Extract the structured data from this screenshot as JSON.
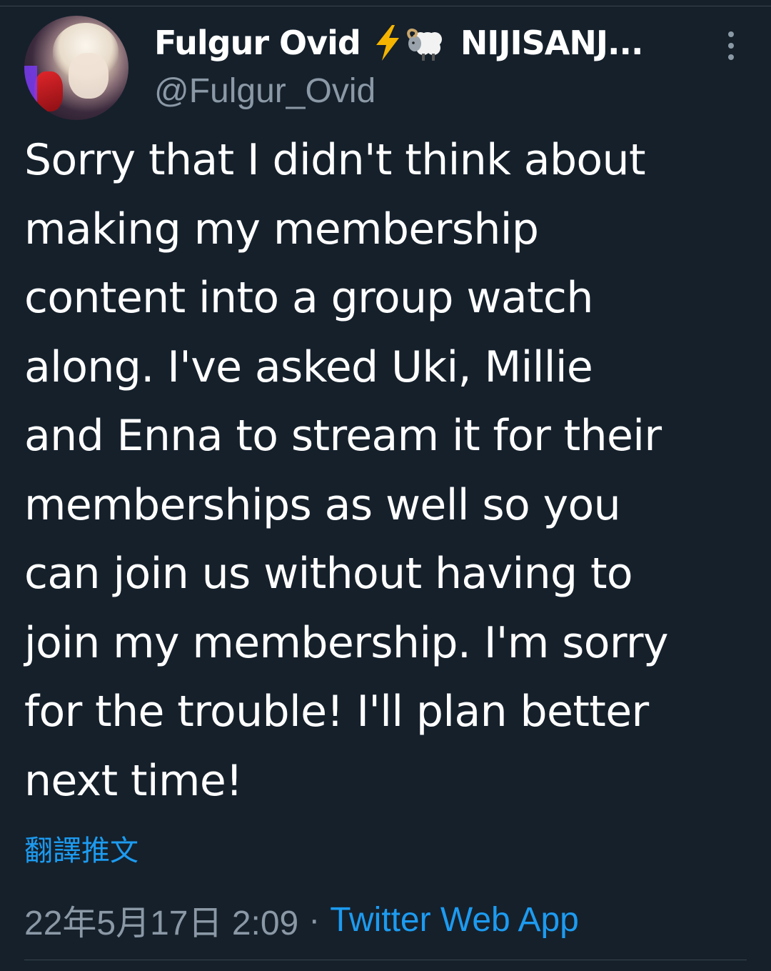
{
  "author": {
    "display_name": "Fulgur Ovid",
    "badge_icons": [
      "lightning-bolt-emoji",
      "sheep-emoji"
    ],
    "org_name": "NIJISANJ...",
    "handle": "@Fulgur_Ovid"
  },
  "tweet": {
    "text": "Sorry that I didn't think about\nmaking my membership\ncontent into a group watch\nalong. I've asked Uki, Millie\nand Enna to stream it for their\nmemberships as well so you\ncan join us without having to\njoin my membership. I'm sorry\nfor the trouble! I'll plan better\nnext time!",
    "translate_label": "翻譯推文",
    "timestamp": "22年5月17日 2:09",
    "separator": "·",
    "source": "Twitter Web App"
  },
  "colors": {
    "background": "#15202b",
    "text_primary": "#ffffff",
    "text_secondary": "#8b98a5",
    "accent_link": "#1d9bf0",
    "divider": "#38444d",
    "bolt": "#f4b400"
  }
}
